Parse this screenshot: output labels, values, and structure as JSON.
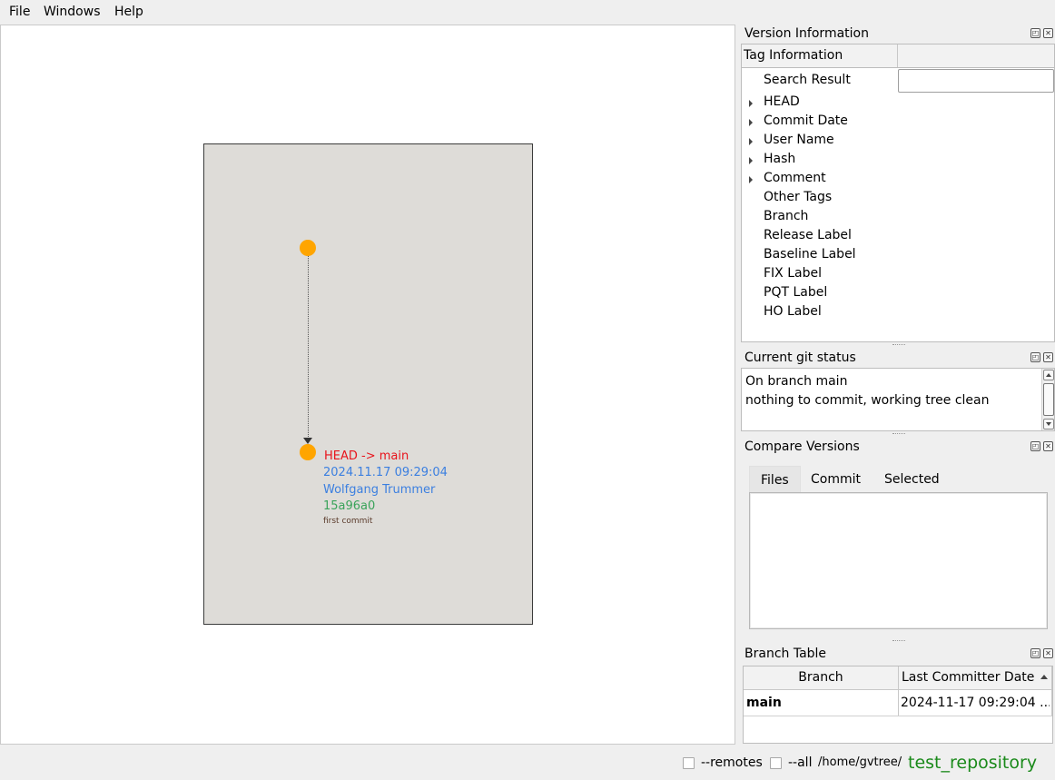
{
  "menu": {
    "file": "File",
    "windows": "Windows",
    "help": "Help"
  },
  "graph": {
    "commits": [
      {
        "head": "HEAD -> main",
        "date": "2024.11.17 09:29:04",
        "user": "Wolfgang Trummer",
        "hash": "15a96a0",
        "message": "first commit"
      }
    ],
    "colors": {
      "node": "#ffa500",
      "head": "#e8141c",
      "date": "#3b7fe0",
      "user": "#3b7fe0",
      "hash": "#3aa35a",
      "message": "#5a3a2a",
      "scene_bg": "#dedcd8"
    }
  },
  "version_info": {
    "title": "Version Information",
    "header": {
      "col1": "Tag Information",
      "col2": ""
    },
    "search_label": "Search Result",
    "search_value": "",
    "items": [
      {
        "label": "HEAD",
        "expandable": true
      },
      {
        "label": "Commit Date",
        "expandable": true
      },
      {
        "label": "User Name",
        "expandable": true
      },
      {
        "label": "Hash",
        "expandable": true
      },
      {
        "label": "Comment",
        "expandable": true
      },
      {
        "label": "Other Tags",
        "expandable": false
      },
      {
        "label": "Branch",
        "expandable": false
      },
      {
        "label": "Release Label",
        "expandable": false
      },
      {
        "label": "Baseline Label",
        "expandable": false
      },
      {
        "label": "FIX Label",
        "expandable": false
      },
      {
        "label": "PQT Label",
        "expandable": false
      },
      {
        "label": "HO Label",
        "expandable": false
      }
    ]
  },
  "git_status": {
    "title": "Current git status",
    "lines": [
      "On branch main",
      "nothing to commit, working tree clean"
    ]
  },
  "compare_versions": {
    "title": "Compare Versions",
    "tabs": [
      "Files",
      "Commit",
      "Selected"
    ],
    "active_tab": "Files"
  },
  "branch_table": {
    "title": "Branch Table",
    "columns": [
      "Branch",
      "Last Committer Date"
    ],
    "rows": [
      {
        "branch": "main",
        "date": "2024-11-17 09:29:04 ..."
      }
    ]
  },
  "statusbar": {
    "remotes_label": "--remotes",
    "remotes_checked": false,
    "all_label": "--all",
    "all_checked": false,
    "path": "/home/gvtree/",
    "repository": "test_repository",
    "repository_color": "#1a8a1a"
  }
}
